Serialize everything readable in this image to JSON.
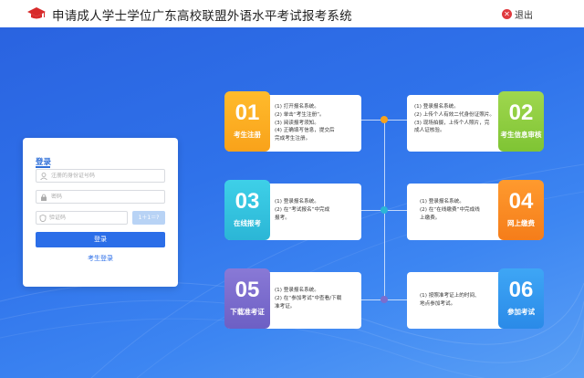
{
  "header": {
    "title": "申请成人学士学位广东高校联盟外语水平考试报考系统",
    "logout_label": "退出"
  },
  "login": {
    "title": "登录",
    "id_placeholder": "注册的身份证号码",
    "password_placeholder": "密码",
    "captcha_placeholder": "验证码",
    "captcha_text": "1＋1＝?",
    "login_button": "登录",
    "register_link": "考生登录"
  },
  "steps": [
    {
      "num": "01",
      "label": "考生注册",
      "lines": [
        "(1) 打开报名系统。",
        "(2) 单击“考生注册”。",
        "(3) 阅读报考须知。",
        "(4) 正确填写信息，提交后",
        "     完成考生注册。"
      ]
    },
    {
      "num": "02",
      "label": "考生信息审核",
      "lines": [
        "(1) 登录报名系统。",
        "(2) 上传个人有效二代身份证照片。",
        "(3) 现场拍摄，上传个人照片，完",
        "     成人证核验。"
      ]
    },
    {
      "num": "03",
      "label": "在线报考",
      "lines": [
        "(1) 登录报名系统。",
        "(2) 在“考试报名”中完成",
        "     报考。"
      ]
    },
    {
      "num": "04",
      "label": "网上缴费",
      "lines": [
        "(1) 登录报名系统。",
        "(2) 在“在线缴费”中完成线",
        "     上缴费。"
      ]
    },
    {
      "num": "05",
      "label": "下载准考证",
      "lines": [
        "(1) 登录报名系统。",
        "(2) 在“参加考试”中查看/下载",
        "     准考证。"
      ]
    },
    {
      "num": "06",
      "label": "参加考试",
      "lines": [
        "(1) 按照准考证上的时间、",
        "     地点参加考试。"
      ]
    }
  ],
  "colors": {
    "accent": "#2b6ee8",
    "step1": "#f9a21a",
    "step2": "#7fc434",
    "step3": "#2bb6d6",
    "step4": "#f57d1a",
    "step5": "#6d5fc4",
    "step6": "#2a8ae8"
  }
}
